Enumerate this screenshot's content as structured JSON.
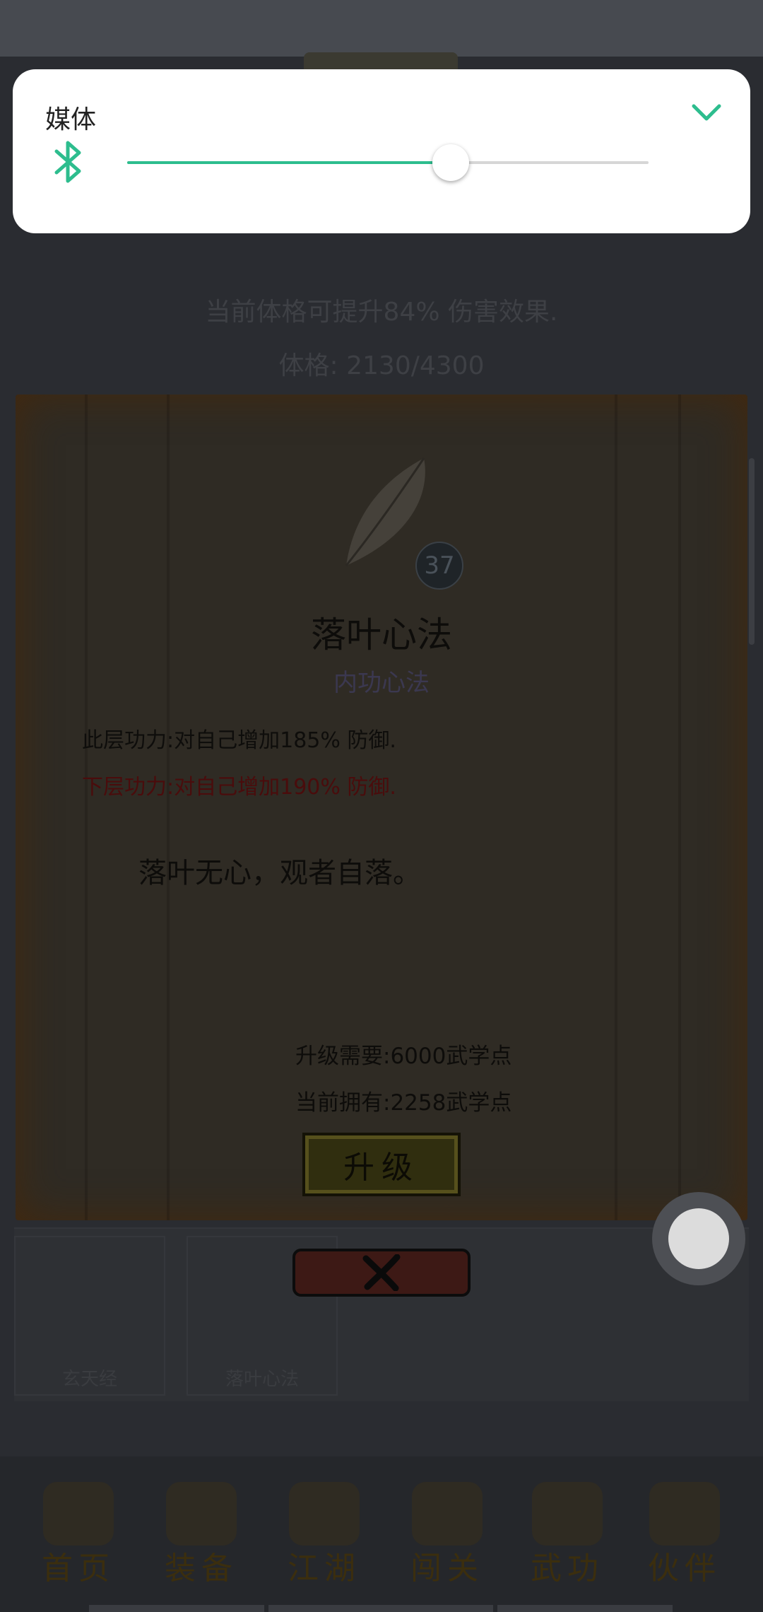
{
  "volume_panel": {
    "title": "媒体",
    "output_icon": "bluetooth-icon",
    "level": 0.62,
    "accent_color": "#2dbd8e",
    "collapse_icon": "chevron-down-icon"
  },
  "stats": {
    "bonus_text": "当前体格可提升84% 伤害效果.",
    "physique_line": "体格:   2130/4300"
  },
  "skill_detail": {
    "level": "37",
    "name": "落叶心法",
    "type": "内功心法",
    "current_effect": "此层功力:对自己增加185% 防御.",
    "next_effect": "下层功力:对自己增加190% 防御.",
    "quote": "落叶无心，观者自落。",
    "upgrade_cost": "升级需要:6000武学点",
    "current_points": "当前拥有:2258武学点",
    "upgrade_label": "升级",
    "close_label": "✕"
  },
  "skill_list": [
    {
      "name": "玄天经"
    },
    {
      "name": "落叶心法"
    }
  ],
  "bottom_nav": [
    {
      "label": "首页",
      "icon": "home-icon"
    },
    {
      "label": "装备",
      "icon": "equipment-icon"
    },
    {
      "label": "江湖",
      "icon": "jianghu-icon"
    },
    {
      "label": "闯关",
      "icon": "stage-icon"
    },
    {
      "label": "武功",
      "icon": "martial-arts-icon"
    },
    {
      "label": "伙伴",
      "icon": "partners-icon"
    }
  ]
}
